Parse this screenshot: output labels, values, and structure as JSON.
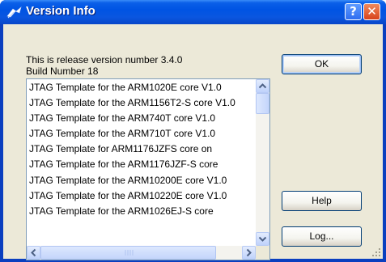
{
  "window": {
    "title": "Version Info",
    "colors": {
      "titlebar": "#0054e3",
      "client": "#ece9d8",
      "close_button": "#d8431c"
    }
  },
  "info": {
    "version_line": "This is release version number 3.4.0",
    "build_line": "Build Number 18"
  },
  "buttons": {
    "ok": "OK",
    "help": "Help",
    "log": "Log...",
    "title_help": "?",
    "title_close": "✕"
  },
  "templates": {
    "items": [
      "JTAG Template for the ARM1020E core V1.0",
      "JTAG Template for the ARM1156T2-S core V1.0",
      "JTAG Template for the ARM740T core V1.0",
      "JTAG Template for the ARM710T core V1.0",
      "JTAG Template for ARM1176JZFS core on",
      "JTAG Template for the ARM1176JZF-S core",
      "JTAG Template for the ARM10200E core V1.0",
      "JTAG Template for the ARM10220E core V1.0",
      "JTAG Template for the ARM1026EJ-S core"
    ]
  },
  "icons": {
    "title": "version-info-icon",
    "scroll_up": "arrow-up-icon",
    "scroll_down": "arrow-down-icon",
    "scroll_left": "arrow-left-icon",
    "scroll_right": "arrow-right-icon",
    "resize": "resize-grip-icon"
  }
}
